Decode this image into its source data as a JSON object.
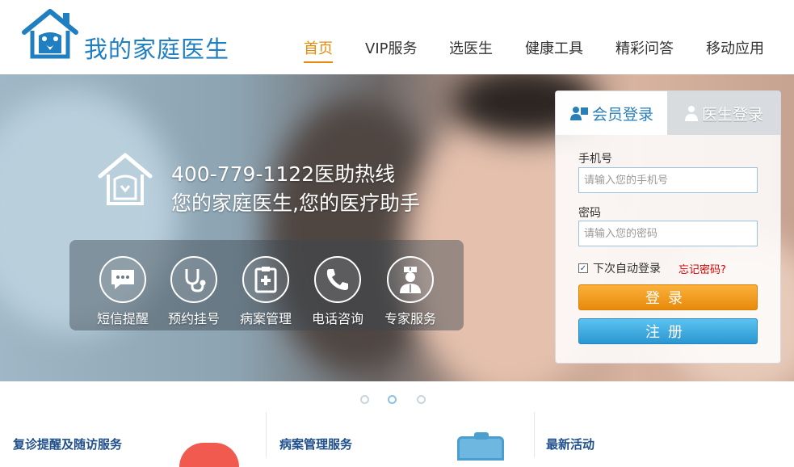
{
  "header": {
    "brand": "我的家庭医生",
    "nav": [
      {
        "label": "首页",
        "active": true
      },
      {
        "label": "VIP服务",
        "active": false
      },
      {
        "label": "选医生",
        "active": false
      },
      {
        "label": "健康工具",
        "active": false
      },
      {
        "label": "精彩问答",
        "active": false
      },
      {
        "label": "移动应用",
        "active": false
      }
    ]
  },
  "banner": {
    "hotline": "400-779-1122医助热线",
    "slogan": "您的家庭医生,您的医疗助手",
    "services": [
      {
        "label": "短信提醒",
        "icon": "sms-bubble-icon"
      },
      {
        "label": "预约挂号",
        "icon": "stethoscope-icon"
      },
      {
        "label": "病案管理",
        "icon": "medical-record-icon"
      },
      {
        "label": "电话咨询",
        "icon": "phone-icon"
      },
      {
        "label": "专家服务",
        "icon": "doctor-icon"
      }
    ]
  },
  "login": {
    "tab_member": "会员登录",
    "tab_doctor": "医生登录",
    "phone_label": "手机号",
    "phone_placeholder": "请输入您的手机号",
    "password_label": "密码",
    "password_placeholder": "请输入您的密码",
    "remember_label": "下次自动登录",
    "remember_checked": true,
    "forgot": "忘记密码?",
    "login_button": "登录",
    "register_button": "注册"
  },
  "carousel": {
    "dots": 3,
    "active_index": 1
  },
  "sections": [
    {
      "title": "复诊提醒及随访服务"
    },
    {
      "title": "病案管理服务"
    },
    {
      "title": "最新活动"
    }
  ],
  "colors": {
    "brand": "#1f7fc1",
    "nav_active": "#e8890a",
    "login_button": "#f39c12",
    "register_button": "#2b96d2",
    "forgot": "#dd0000"
  }
}
